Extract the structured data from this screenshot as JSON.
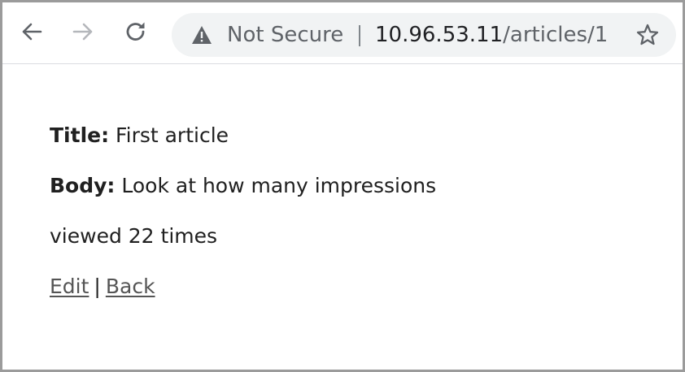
{
  "browser": {
    "security_label": "Not Secure",
    "url_host": "10.96.53.11",
    "url_path": "/articles/1",
    "icons": {
      "back": "arrow-left-icon",
      "forward": "arrow-right-icon",
      "reload": "reload-icon",
      "security": "warning-triangle-icon",
      "bookmark": "star-icon"
    }
  },
  "article": {
    "title_label": "Title:",
    "title_value": " First article",
    "body_label": "Body:",
    "body_value": " Look at how many impressions",
    "views_text": "viewed 22 times"
  },
  "links": {
    "edit": "Edit",
    "separator": "|",
    "back": "Back"
  },
  "colors": {
    "omnibox_bg": "#f1f3f4",
    "link": "#555555",
    "frame_border": "#9b9b9b"
  }
}
